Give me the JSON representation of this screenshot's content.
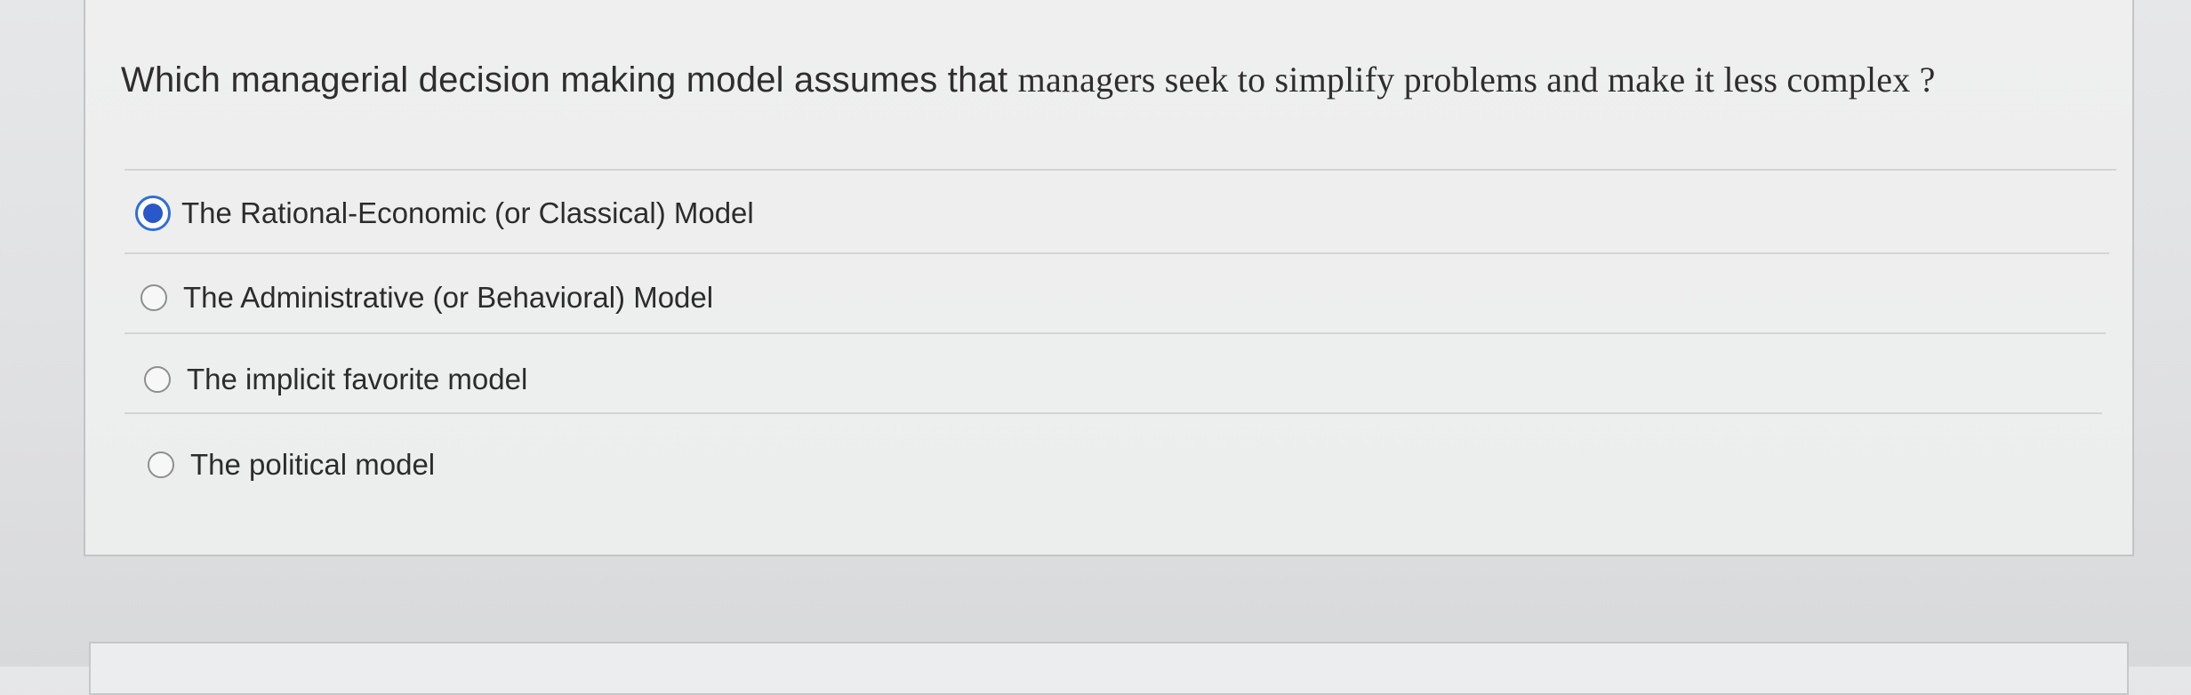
{
  "question": {
    "text_part1": "Which managerial decision making model assumes that ",
    "text_part2": "managers seek to simplify problems and make it less complex ?"
  },
  "options": [
    {
      "label": "The Rational-Economic (or Classical) Model",
      "selected": true
    },
    {
      "label": "The Administrative (or Behavioral) Model",
      "selected": false
    },
    {
      "label": "The implicit favorite model",
      "selected": false
    },
    {
      "label": "The political model",
      "selected": false
    }
  ],
  "colors": {
    "radio_selected": "#2a58c8",
    "radio_border": "#8d8e90",
    "card_background": "#efefef"
  }
}
